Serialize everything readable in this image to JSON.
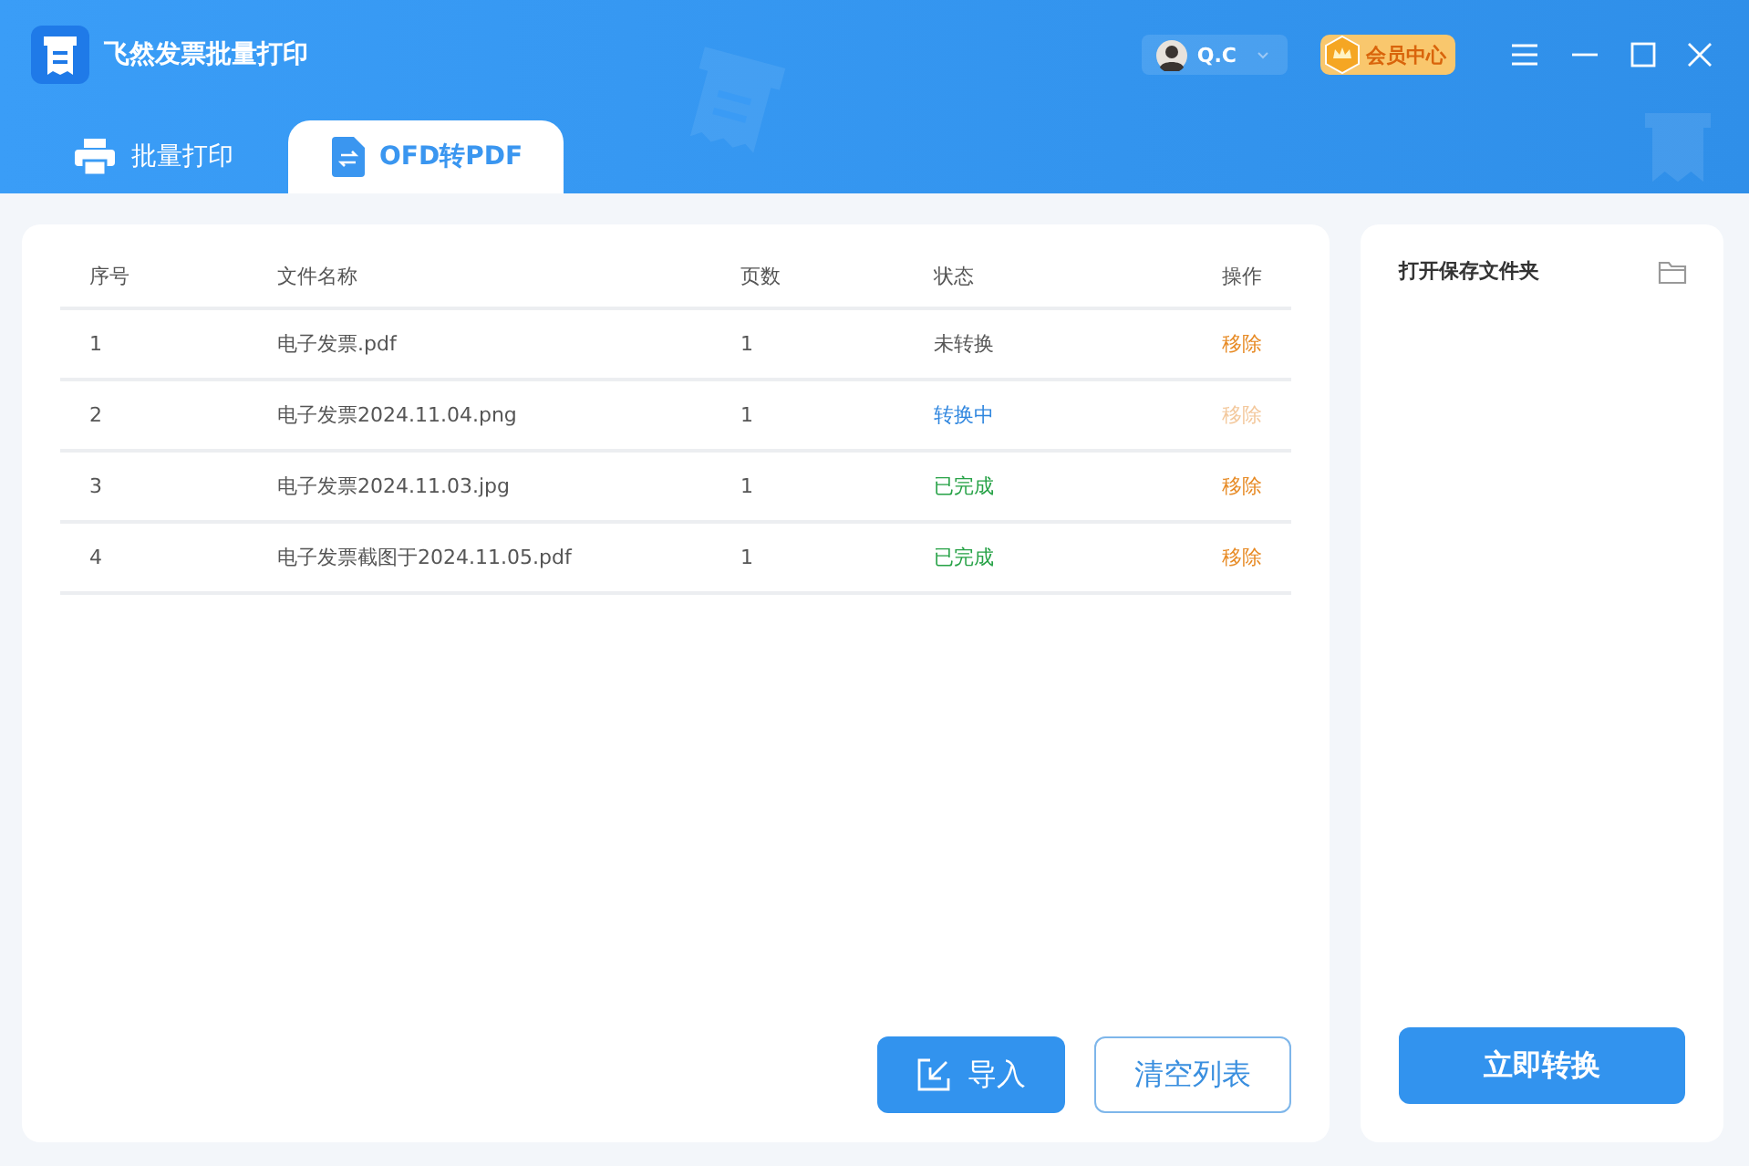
{
  "window": {
    "title": "飞然发票批量打印"
  },
  "user": {
    "name": "Q.C"
  },
  "vip": {
    "label": "会员中心"
  },
  "tabs": [
    {
      "label": "批量打印",
      "selected": false,
      "kind": "print"
    },
    {
      "label": "OFD转PDF",
      "selected": true,
      "kind": "convert"
    }
  ],
  "table": {
    "columns": [
      "序号",
      "文件名称",
      "页数",
      "状态",
      "操作"
    ],
    "rows": [
      {
        "index": "1",
        "file": "电子发票.pdf",
        "pages": "1",
        "status": "未转换",
        "color": "#555555",
        "action": "移除",
        "disabled": false
      },
      {
        "index": "2",
        "file": "电子发票2024.11.04.png",
        "pages": "1",
        "status": "转换中",
        "color": "#2f86df",
        "action": "移除",
        "disabled": true
      },
      {
        "index": "3",
        "file": "电子发票2024.11.03.jpg",
        "pages": "1",
        "status": "已完成",
        "color": "#27a247",
        "action": "移除",
        "disabled": false
      },
      {
        "index": "4",
        "file": "电子发票截图于2024.11.05.pdf",
        "pages": "1",
        "status": "已完成",
        "color": "#27a247",
        "action": "移除",
        "disabled": false
      }
    ]
  },
  "buttons": {
    "import": "导入",
    "clear": "清空列表"
  },
  "side": {
    "folder_label": "打开保存文件夹",
    "convert": "立即转换"
  }
}
